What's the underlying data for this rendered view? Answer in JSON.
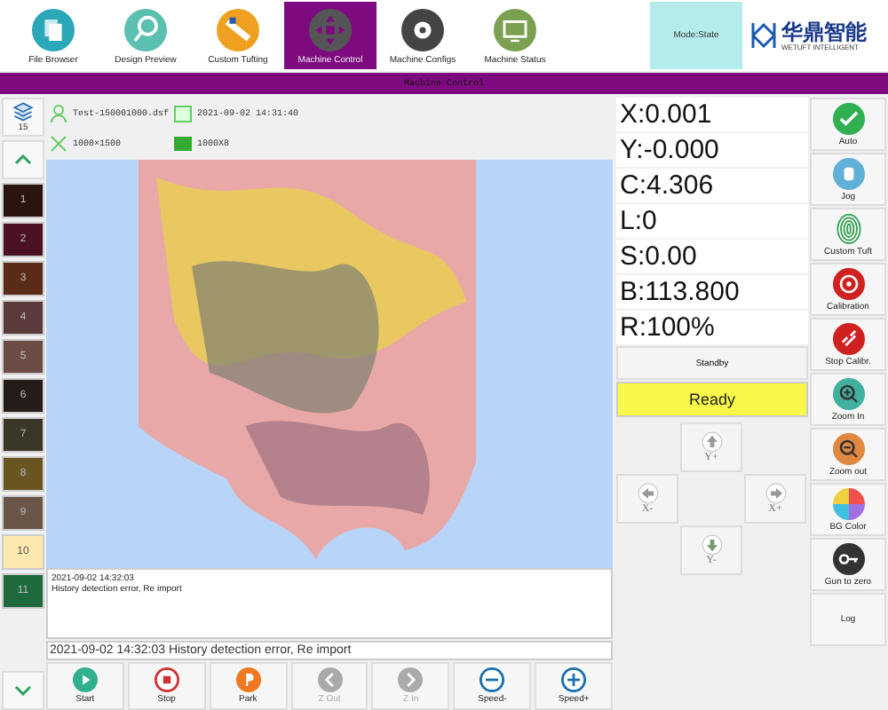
{
  "nav": {
    "tabs": [
      {
        "label": "File Browser",
        "kind": "files",
        "selected": false
      },
      {
        "label": "Design Preview",
        "kind": "search",
        "selected": false
      },
      {
        "label": "Custom Tufting",
        "kind": "gun",
        "selected": false
      },
      {
        "label": "Machine Control",
        "kind": "pad",
        "selected": true
      },
      {
        "label": "Machine Configs",
        "kind": "gear",
        "selected": false
      },
      {
        "label": "Machine Status",
        "kind": "monitor",
        "selected": false
      }
    ],
    "mode_state": "Mode:State",
    "logo": {
      "name": "华鼎智能",
      "sub": "WETUFT INTELLIGENT"
    }
  },
  "title_bar": "Machine Control",
  "layers": {
    "count": "15",
    "colors": [
      {
        "label": "1",
        "color": "#2a1410"
      },
      {
        "label": "2",
        "color": "#4a1222"
      },
      {
        "label": "3",
        "color": "#5a2c18"
      },
      {
        "label": "4",
        "color": "#5a3a3a"
      },
      {
        "label": "5",
        "color": "#6c4c44"
      },
      {
        "label": "6",
        "color": "#241c18"
      },
      {
        "label": "7",
        "color": "#3a3628"
      },
      {
        "label": "8",
        "color": "#6a5422"
      },
      {
        "label": "9",
        "color": "#6a5648"
      },
      {
        "label": "10",
        "color": "#fde9b0"
      },
      {
        "label": "11",
        "color": "#1e6a3c"
      }
    ]
  },
  "file_info": {
    "file_name": "Test-150001000.dsf",
    "date": "2021-09-02 14:31:40",
    "size": "1000×1500",
    "density": "1000X8"
  },
  "log": {
    "time": "2021-09-02 14:32:03",
    "message": "History detection error, Re import"
  },
  "status_line": "2021-09-02 14:32:03 History detection error, Re import",
  "bottom_buttons": [
    {
      "label": "Start",
      "kind": "play",
      "disabled": false
    },
    {
      "label": "Stop",
      "kind": "stop",
      "disabled": false
    },
    {
      "label": "Park",
      "kind": "park",
      "disabled": false
    },
    {
      "label": "Z Out",
      "kind": "left",
      "disabled": true
    },
    {
      "label": "Z In",
      "kind": "right",
      "disabled": true
    },
    {
      "label": "Speed-",
      "kind": "minus",
      "disabled": false
    },
    {
      "label": "Speed+",
      "kind": "plus",
      "disabled": false
    }
  ],
  "readouts": [
    "X:0.001",
    "Y:-0.000",
    "C:4.306",
    "L:0",
    "S:0.00",
    "B:113.800",
    "R:100%"
  ],
  "standby": "Standby",
  "ready": "Ready",
  "jog": {
    "up": "Y+",
    "left": "X-",
    "right": "X+",
    "down": "Y-"
  },
  "side_buttons": [
    {
      "label": "Auto",
      "kind": "check"
    },
    {
      "label": "Jog",
      "kind": "hand"
    },
    {
      "label": "Custom Tuft",
      "kind": "finger"
    },
    {
      "label": "Calibration",
      "kind": "target"
    },
    {
      "label": "Stop Calibr.",
      "kind": "unlink"
    },
    {
      "label": "Zoom In",
      "kind": "zoomin"
    },
    {
      "label": "Zoom out",
      "kind": "zoomout"
    },
    {
      "label": "BG Color",
      "kind": "wheel"
    },
    {
      "label": "Gun to zero",
      "kind": "key"
    },
    {
      "label": "Log",
      "kind": "text"
    }
  ]
}
